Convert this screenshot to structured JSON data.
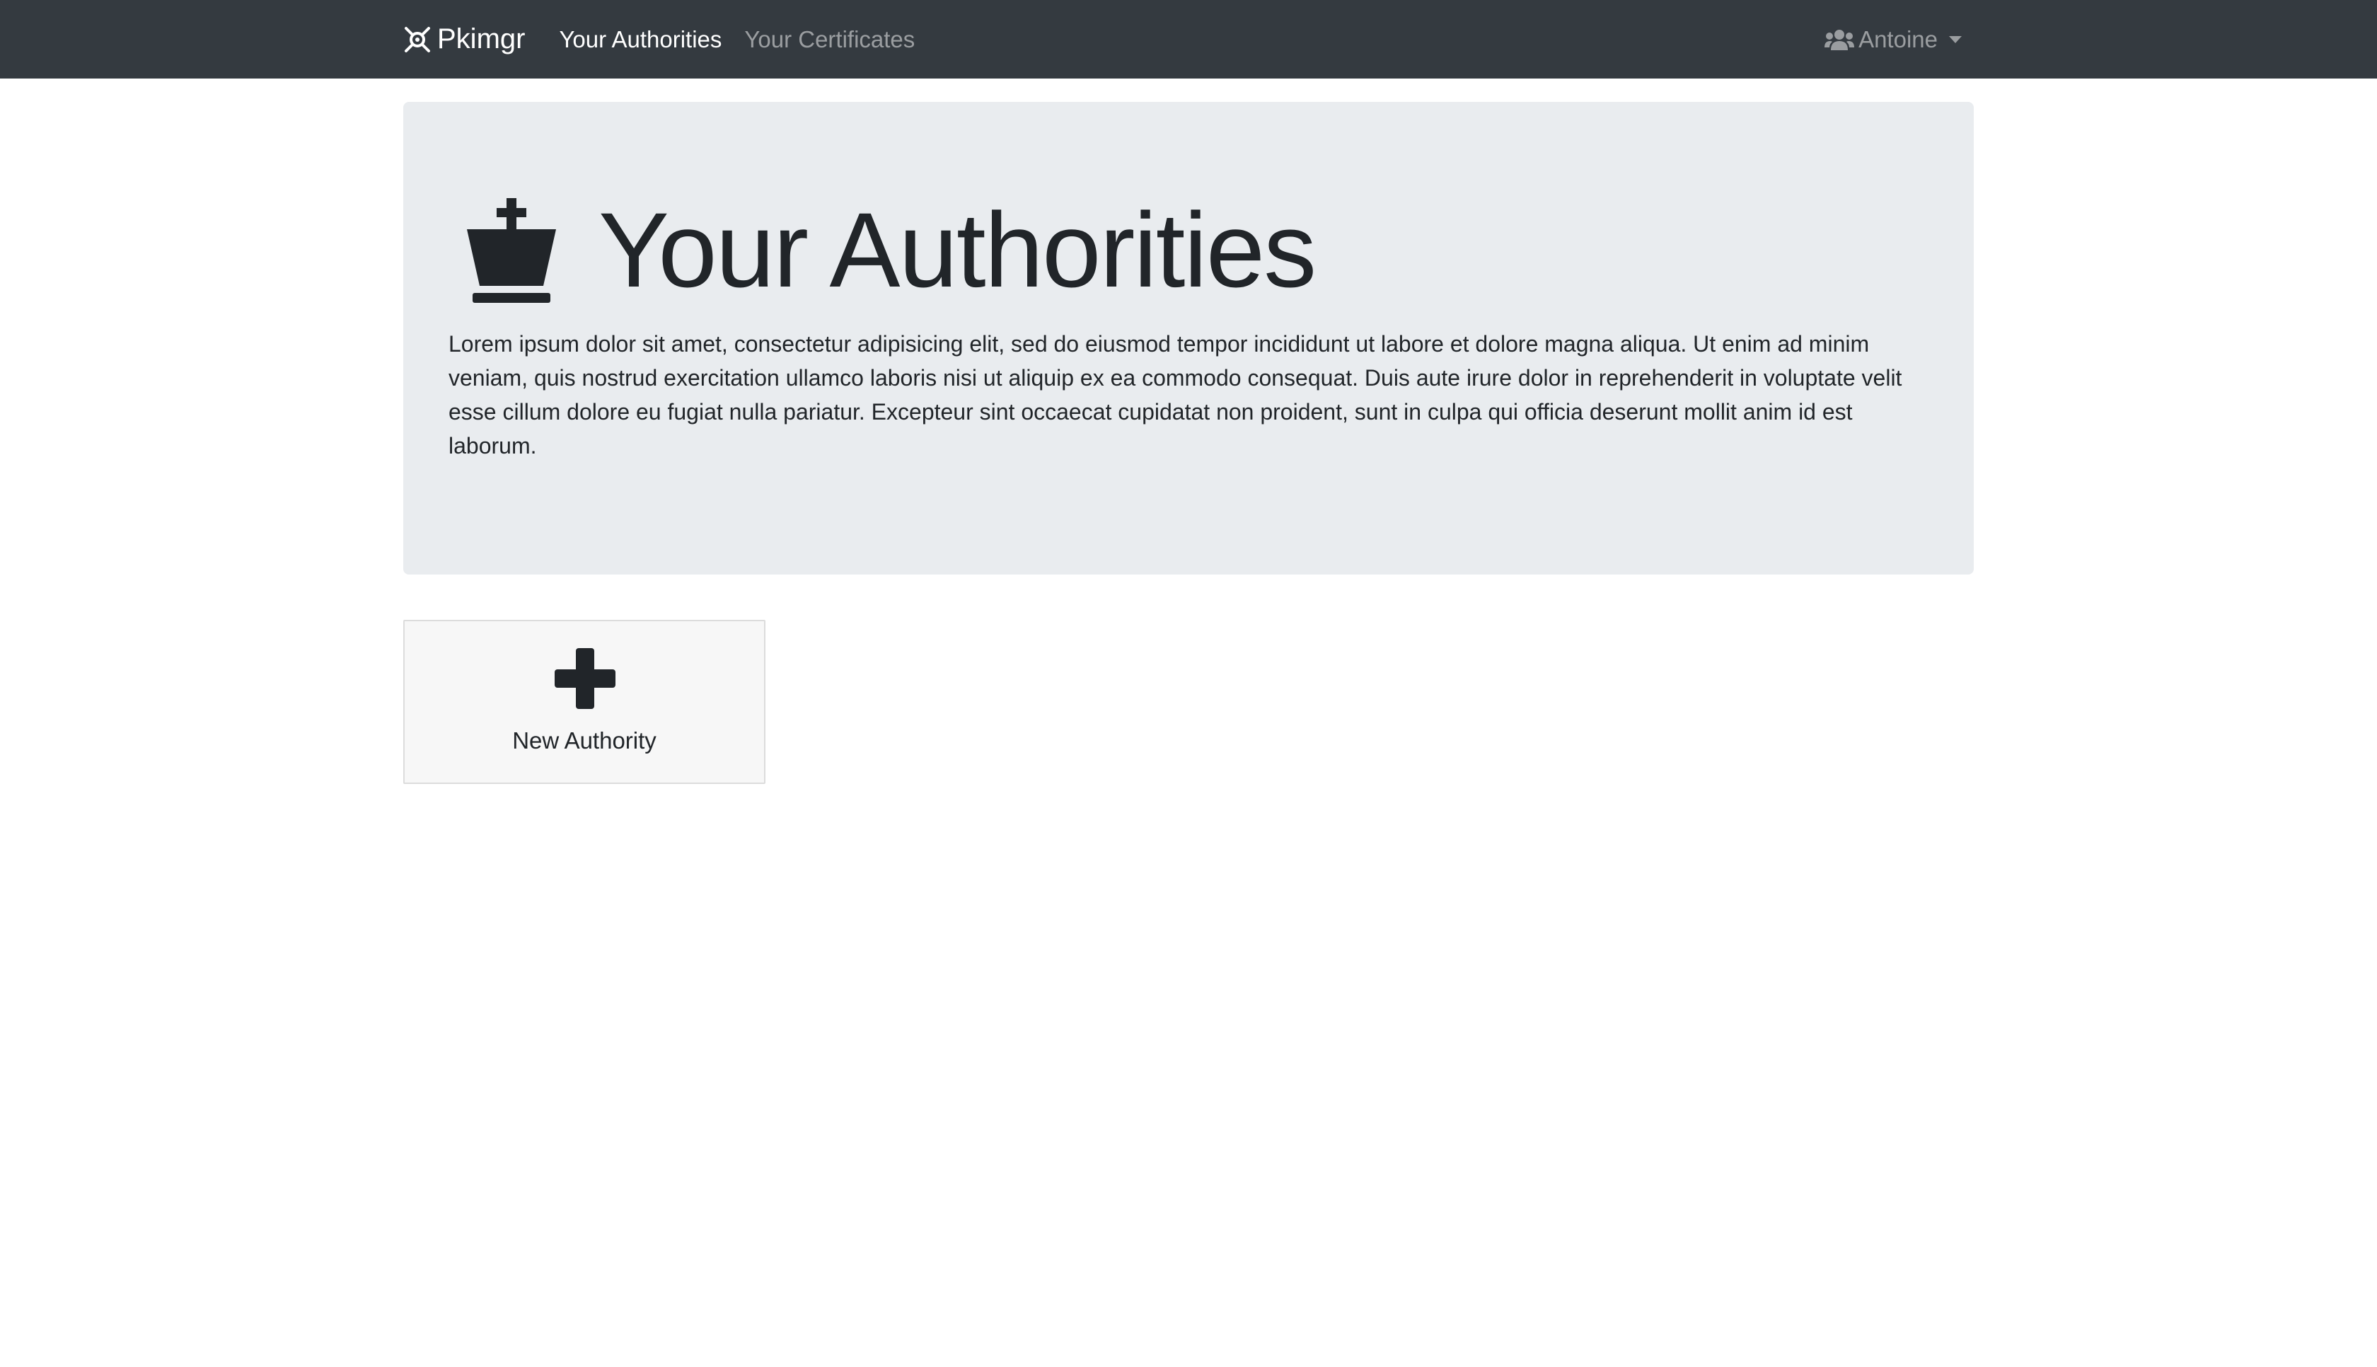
{
  "navbar": {
    "brand": "Pkimgr",
    "links": [
      {
        "label": "Your Authorities",
        "active": true
      },
      {
        "label": "Your Certificates",
        "active": false
      }
    ],
    "user": "Antoine"
  },
  "jumbotron": {
    "title": "Your Authorities",
    "description": "Lorem ipsum dolor sit amet, consectetur adipisicing elit, sed do eiusmod tempor incididunt ut labore et dolore magna aliqua. Ut enim ad minim veniam, quis nostrud exercitation ullamco laboris nisi ut aliquip ex ea commodo consequat. Duis aute irure dolor in reprehenderit in voluptate velit esse cillum dolore eu fugiat nulla pariatur. Excepteur sint occaecat cupidatat non proident, sunt in culpa qui officia deserunt mollit anim id est laborum.",
    "icon": "chess-king-icon"
  },
  "actions": {
    "new_authority_label": "New Authority",
    "new_authority_icon": "plus-icon"
  },
  "colors": {
    "navbar_bg": "#343a40",
    "jumbotron_bg": "#e9ecef",
    "text": "#212529"
  }
}
